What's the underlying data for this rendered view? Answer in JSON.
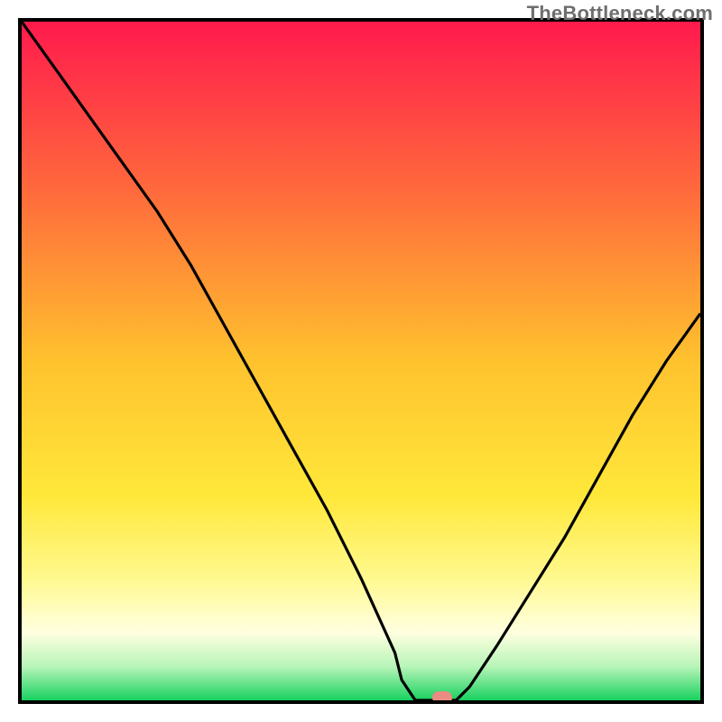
{
  "watermark": "TheBottleneck.com",
  "chart_data": {
    "type": "line",
    "title": "",
    "xlabel": "",
    "ylabel": "",
    "xlim": [
      0,
      100
    ],
    "ylim": [
      0,
      100
    ],
    "x": [
      0,
      5,
      10,
      15,
      20,
      25,
      30,
      35,
      40,
      45,
      50,
      55,
      56,
      58,
      60,
      62,
      64,
      66,
      70,
      75,
      80,
      85,
      90,
      95,
      100
    ],
    "values": [
      100,
      93,
      86,
      79,
      72,
      64,
      55,
      46,
      37,
      28,
      18,
      7,
      3,
      0,
      0,
      0,
      0,
      2,
      8,
      16,
      24,
      33,
      42,
      50,
      57
    ],
    "note": "Values estimated from curve height relative to plot area (0 = bottom/green, 100 = top/red). Minimum at x≈58-64.",
    "gradient_stops": [
      {
        "pos": 0.0,
        "color": "#ff1a4d"
      },
      {
        "pos": 0.25,
        "color": "#ff6a3c"
      },
      {
        "pos": 0.5,
        "color": "#ffc22e"
      },
      {
        "pos": 0.7,
        "color": "#ffe83a"
      },
      {
        "pos": 0.82,
        "color": "#fff98f"
      },
      {
        "pos": 0.9,
        "color": "#ffffe0"
      },
      {
        "pos": 0.95,
        "color": "#b8f5b8"
      },
      {
        "pos": 1.0,
        "color": "#18d160"
      }
    ],
    "marker": {
      "x": 62,
      "y": 0,
      "color": "#eb8b82"
    }
  }
}
